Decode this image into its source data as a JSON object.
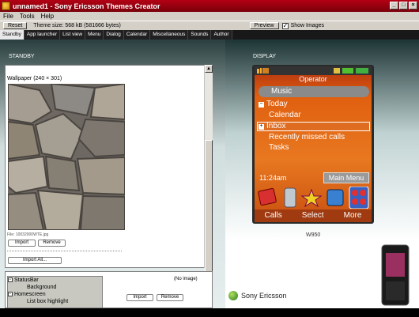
{
  "window": {
    "title": "unnamed1 - Sony Ericsson Themes Creator"
  },
  "menu": [
    "File",
    "Tools",
    "Help"
  ],
  "toolbar": {
    "reset": "Reset",
    "theme_size": "Theme size: 568 kB (581666 bytes)",
    "preview": "Preview",
    "show_images": "Show Images"
  },
  "tabs": [
    "Standby",
    "App launcher",
    "List view",
    "Menu",
    "Dialog",
    "Calendar",
    "Miscellaneous",
    "Sounds",
    "Author"
  ],
  "left": {
    "section": "STANDBY",
    "wallpaper_label": "Wallpaper (240 × 301)",
    "file_label": "File: 10032000WTE.jpg",
    "import": "Import",
    "remove": "Remove",
    "import_all": "Import All...",
    "tree": [
      "StatusBar",
      "Background",
      "Homescreen",
      "List box highlight"
    ],
    "no_image": "(No image)",
    "import2": "Import",
    "remove2": "Remove"
  },
  "right": {
    "section": "DISPLAY",
    "phone": {
      "operator": "Operator",
      "music": "Music",
      "today": "Today",
      "calendar": "Calendar",
      "inbox": "Inbox",
      "recent": "Recently missed calls",
      "tasks": "Tasks",
      "time": "11:24am",
      "main_menu": "Main Menu",
      "soft_left": "Calls",
      "soft_center": "Select",
      "soft_right": "More"
    },
    "model": "W950",
    "brand": "Sony Ericsson"
  }
}
